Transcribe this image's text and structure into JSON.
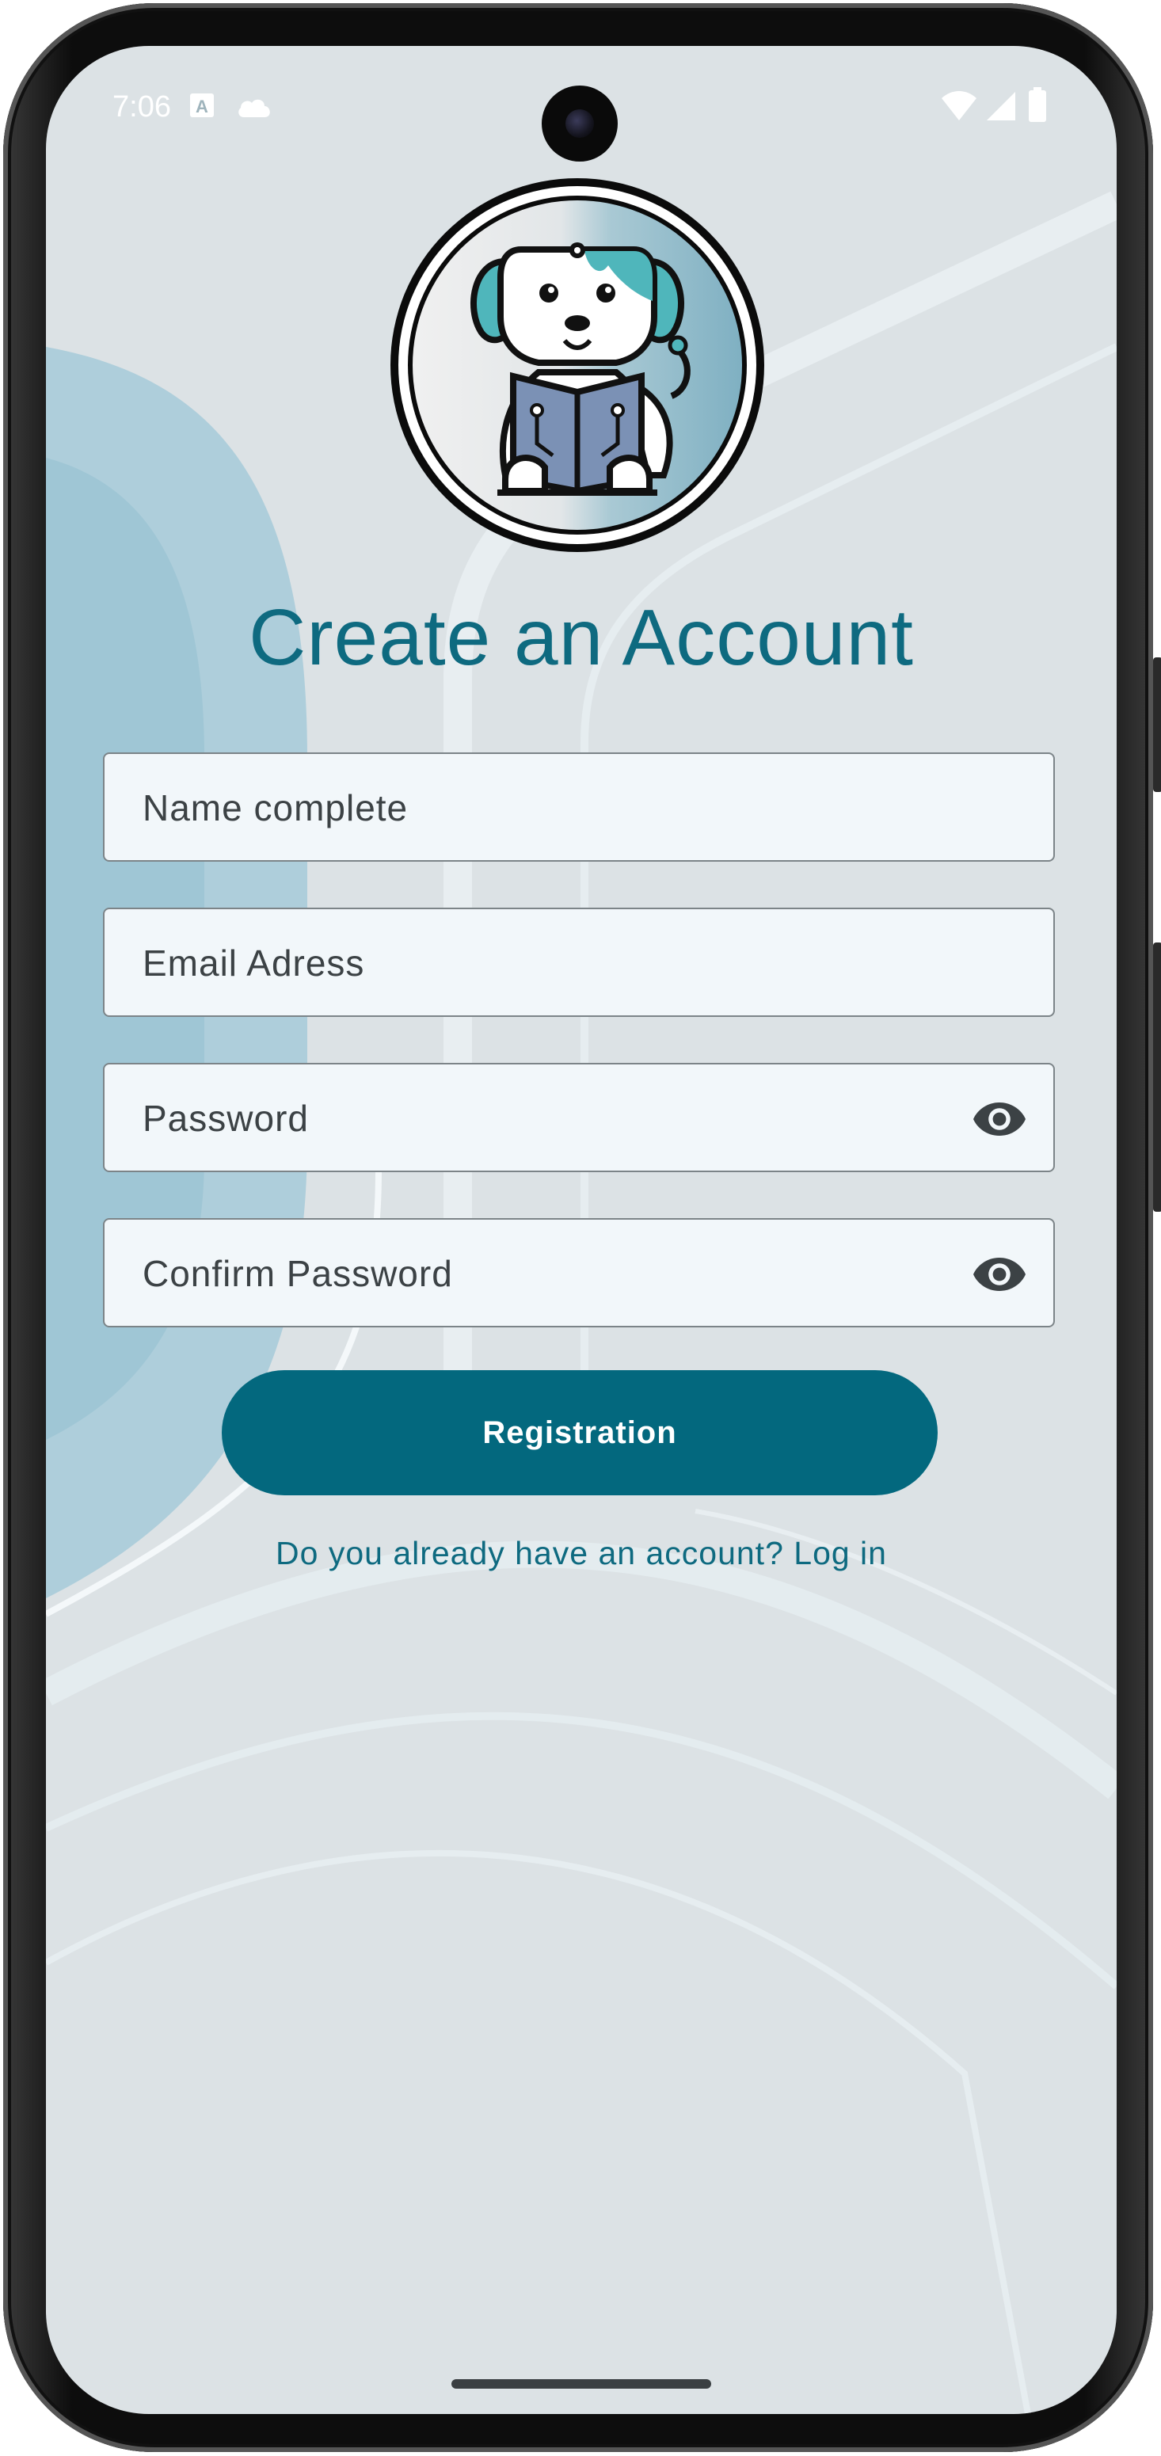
{
  "status_bar": {
    "time": "7:06",
    "icons": [
      "notification-a-icon",
      "cloud-icon",
      "wifi-icon",
      "signal-icon",
      "battery-icon"
    ]
  },
  "logo": {
    "icon": "robot-dog-reading-book-logo"
  },
  "title": "Create an Account",
  "form": {
    "name_placeholder": "Name complete",
    "email_placeholder": "Email Adress",
    "password_placeholder": "Password",
    "confirm_password_placeholder": "Confirm Password",
    "visibility_icon": "eye-icon"
  },
  "register_button": "Registration",
  "login_link": "Do you already have an account? Log in",
  "colors": {
    "primary": "#03687e",
    "title": "#0e6a80",
    "background": "#dce2e5",
    "field_background": "#f2f7fa",
    "field_border": "#7c8488"
  }
}
